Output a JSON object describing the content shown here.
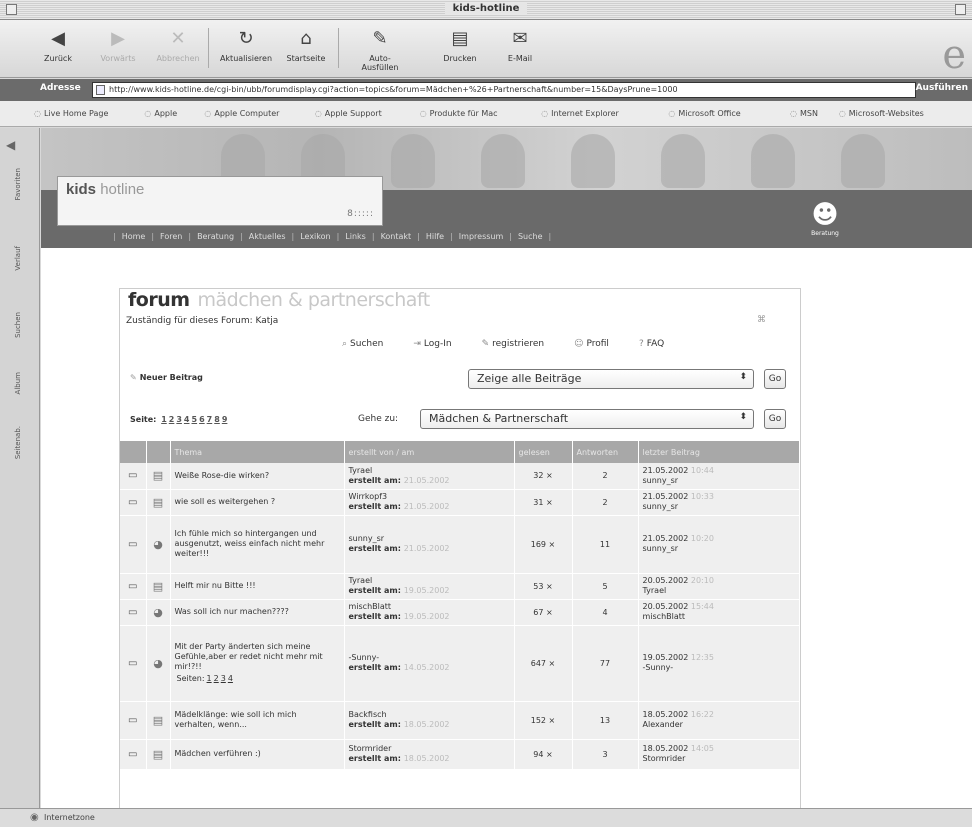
{
  "window": {
    "title": "kids-hotline"
  },
  "toolbar": {
    "buttons": [
      {
        "label": "Zurück",
        "icon": "back-arrow-icon",
        "glyph": "◀",
        "disabled": false
      },
      {
        "label": "Vorwärts",
        "icon": "forward-arrow-icon",
        "glyph": "▶",
        "disabled": true
      },
      {
        "label": "Abbrechen",
        "icon": "stop-icon",
        "glyph": "✕",
        "disabled": true
      },
      {
        "label": "Aktualisieren",
        "icon": "refresh-icon",
        "glyph": "↻",
        "disabled": false
      },
      {
        "label": "Startseite",
        "icon": "home-icon",
        "glyph": "⌂",
        "disabled": false
      },
      {
        "label": "Auto-Ausfüllen",
        "icon": "autofill-icon",
        "glyph": "✎",
        "disabled": false
      },
      {
        "label": "Drucken",
        "icon": "print-icon",
        "glyph": "▤",
        "disabled": false
      },
      {
        "label": "E-Mail",
        "icon": "mail-icon",
        "glyph": "✉",
        "disabled": false
      }
    ]
  },
  "address": {
    "label": "Adresse",
    "url": "http://www.kids-hotline.de/cgi-bin/ubb/forumdisplay.cgi?action=topics&forum=Mädchen+%26+Partnerschaft&number=15&DaysPrune=1000",
    "go_label": "Ausführen"
  },
  "favorites": [
    "Live Home Page",
    "Apple",
    "Apple Computer",
    "Apple Support",
    "Produkte für Mac",
    "Internet Explorer",
    "Microsoft Office",
    "MSN",
    "Microsoft-Websites"
  ],
  "sidebar_tabs": [
    "Favoriten",
    "Verlauf",
    "Suchen",
    "Album",
    "Seitenab."
  ],
  "status": "Internetzone",
  "site": {
    "logo_main": "kids",
    "logo_sub": "hotline",
    "logo_dots": "8:::::",
    "nav": [
      "Home",
      "Foren",
      "Beratung",
      "Aktuelles",
      "Lexikon",
      "Links",
      "Kontakt",
      "Hilfe",
      "Impressum",
      "Suche"
    ],
    "mascot_label": "Beratung"
  },
  "forum": {
    "title": "forum",
    "subtitle": "mädchen & partnerschaft",
    "moderator": "Zuständig für dieses Forum: Katja",
    "actions": [
      {
        "label": "Suchen",
        "icon": "search-icon",
        "glyph": "⌕"
      },
      {
        "label": "Log-In",
        "icon": "login-icon",
        "glyph": "⇥"
      },
      {
        "label": "registrieren",
        "icon": "register-icon",
        "glyph": "✎"
      },
      {
        "label": "Profil",
        "icon": "profile-icon",
        "glyph": "☺"
      },
      {
        "label": "FAQ",
        "icon": "faq-icon",
        "glyph": "?"
      }
    ],
    "new_post": "Neuer Beitrag",
    "filter_select": "Zeige alle Beiträge",
    "go_label": "Go",
    "pages_label": "Seite:",
    "pages": [
      "1",
      "2",
      "3",
      "4",
      "5",
      "6",
      "7",
      "8",
      "9"
    ],
    "goto_label": "Gehe zu:",
    "goto_select": "Mädchen & Partnerschaft",
    "columns": [
      "Thema",
      "erstellt von / am",
      "gelesen",
      "Antworten",
      "letzter Beitrag"
    ],
    "rows": [
      {
        "topic": "Weiße Rose-die wirken?",
        "author": "Tyrael",
        "created": "21.05.2002",
        "views": "32 ×",
        "replies": "2",
        "last_date": "21.05.2002",
        "last_time": "10:44",
        "last_user": "sunny_sr",
        "type": "page",
        "pagelinks": []
      },
      {
        "topic": "wie soll es weitergehen ?",
        "author": "Wirrkopf3",
        "created": "21.05.2002",
        "views": "31 ×",
        "replies": "2",
        "last_date": "21.05.2002",
        "last_time": "10:33",
        "last_user": "sunny_sr",
        "type": "page",
        "pagelinks": []
      },
      {
        "topic": "Ich fühle mich so hintergangen und ausgenutzt, weiss einfach nicht mehr weiter!!!",
        "author": "sunny_sr",
        "created": "21.05.2002",
        "views": "169 ×",
        "replies": "11",
        "last_date": "21.05.2002",
        "last_time": "10:20",
        "last_user": "sunny_sr",
        "type": "hot",
        "pagelinks": []
      },
      {
        "topic": "Helft mir nu Bitte !!!",
        "author": "Tyrael",
        "created": "19.05.2002",
        "views": "53 ×",
        "replies": "5",
        "last_date": "20.05.2002",
        "last_time": "20:10",
        "last_user": "Tyrael",
        "type": "page",
        "pagelinks": []
      },
      {
        "topic": "Was soll ich nur machen????",
        "author": "mischBlatt",
        "created": "19.05.2002",
        "views": "67 ×",
        "replies": "4",
        "last_date": "20.05.2002",
        "last_time": "15:44",
        "last_user": "mischBlatt",
        "type": "hot",
        "pagelinks": []
      },
      {
        "topic": "Mit der Party änderten sich meine Gefühle,aber er redet nicht mehr mit mir!?!!",
        "author": "-Sunny-",
        "created": "14.05.2002",
        "views": "647 ×",
        "replies": "77",
        "last_date": "19.05.2002",
        "last_time": "12:35",
        "last_user": "-Sunny-",
        "type": "hot",
        "pagelinks_label": "Seiten:",
        "pagelinks": [
          "1",
          "2",
          "3",
          "4"
        ]
      },
      {
        "topic": "Mädelklänge: wie soll ich mich verhalten, wenn...",
        "author": "Backfisch",
        "created": "18.05.2002",
        "views": "152 ×",
        "replies": "13",
        "last_date": "18.05.2002",
        "last_time": "16:22",
        "last_user": "Alexander",
        "type": "page",
        "pagelinks": []
      },
      {
        "topic": "Mädchen verführen :)",
        "author": "Stormrider",
        "created": "18.05.2002",
        "views": "94 ×",
        "replies": "3",
        "last_date": "18.05.2002",
        "last_time": "14:05",
        "last_user": "Stormrider",
        "type": "page",
        "pagelinks": []
      }
    ],
    "created_label": "erstellt am:"
  }
}
